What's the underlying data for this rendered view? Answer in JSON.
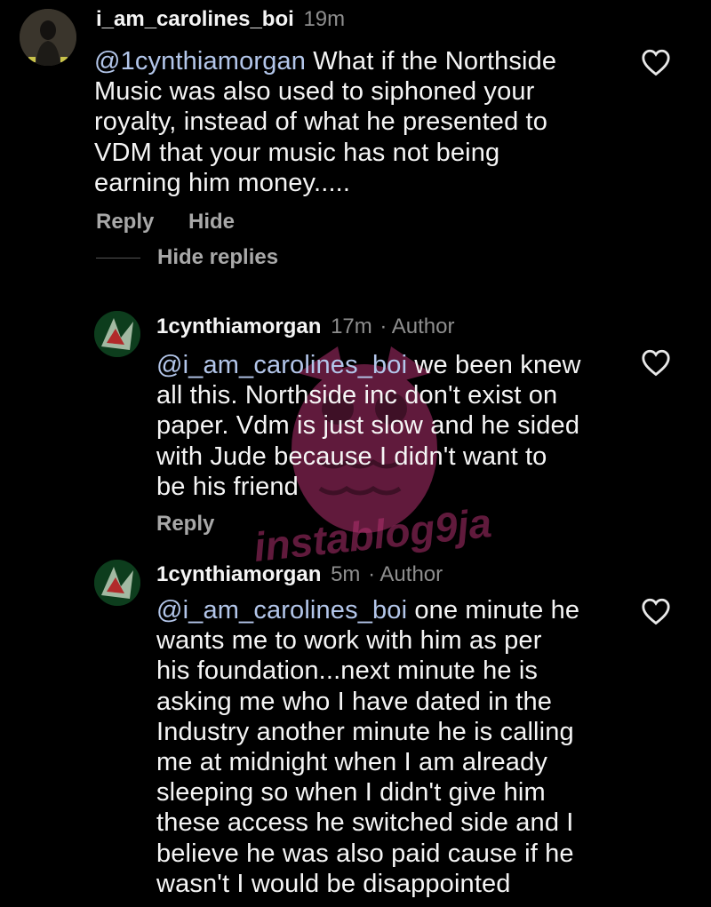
{
  "colors": {
    "background": "#000000",
    "text": "#f5f5f5",
    "muted": "#8e8e8e",
    "mention": "#b3c6ea",
    "action": "#a8a8a8",
    "watermark": "#b0306e"
  },
  "top_comment": {
    "username": "i_am_carolines_boi",
    "time": "19m",
    "mention": "@1cynthiamorgan",
    "lines": [
      "What if the Northside",
      "Music was also used to siphoned your",
      "royalty, instead of what he presented to",
      "VDM that your music has not being",
      "earning him money....."
    ],
    "reply_label": "Reply",
    "hide_label": "Hide",
    "hide_replies_label": "Hide replies",
    "avatar_icon": "user-avatar-icon",
    "like_icon": "heart-outline-icon"
  },
  "replies": [
    {
      "username": "1cynthiamorgan",
      "time": "17m",
      "author_label": "· Author",
      "mention": "@i_am_carolines_boi",
      "lines": [
        "we been knew",
        "all this. Northside inc don't exist on",
        "paper. Vdm is just slow and he sided",
        "with Jude because I didn't want to",
        "be his friend"
      ],
      "reply_label": "Reply",
      "avatar_icon": "author-avatar-icon",
      "like_icon": "heart-outline-icon"
    },
    {
      "username": "1cynthiamorgan",
      "time": "5m",
      "author_label": "· Author",
      "mention": "@i_am_carolines_boi",
      "lines": [
        "one minute he",
        "wants me to work with him as per",
        "his foundation...next minute he is",
        "asking me who I have dated in the",
        "Industry another minute he is calling",
        "me at midnight when I am already",
        "sleeping so when I didn't give him",
        "these access he switched side and I",
        "believe he was also paid cause if he",
        "wasn't I would be disappointed"
      ],
      "avatar_icon": "author-avatar-icon",
      "like_icon": "heart-outline-icon"
    }
  ],
  "watermark": {
    "text": "instablog9ja",
    "icon": "owl-logo-icon"
  }
}
